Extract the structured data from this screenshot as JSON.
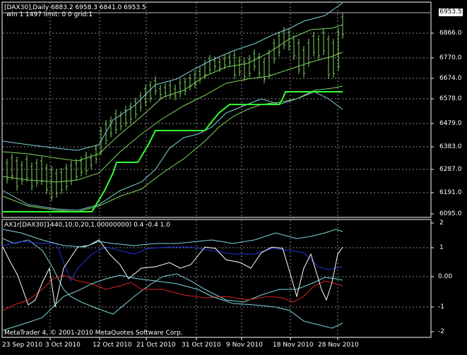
{
  "main_panel": {
    "header_line1": "[DAX30],Daily  6883.2 6958.3 6841.0 6953.5",
    "header_line2": "win 1 1497 limit: 0 0 grid:1",
    "current_price": "6953.5",
    "y_ticks": [
      "6866.0",
      "6770.0",
      "6674.0",
      "6578.0",
      "6479.0",
      "6383.0",
      "6287.0",
      "6191.0",
      "6095.0"
    ]
  },
  "indicator_panel": {
    "header": "AX1r[DAX30]1440,10,0,20,1.00000000) 0.4 -0.4 1.0",
    "y_ticks": [
      "2",
      "1",
      "0.00",
      "-1",
      "-2"
    ],
    "footer": "MetaTrader 4, © 2001-2010 MetaQuotes Software Corp."
  },
  "x_ticks": [
    "23 Sep 2010",
    "3 Oct 2010",
    "12 Oct 2010",
    "21 Oct 2010",
    "31 Oct 2010",
    "9 Nov 2010",
    "18 Nov 2010",
    "28 Nov 2010"
  ],
  "colors": {
    "background": "#000000",
    "grid": "#8a8a8a",
    "bars": "#7cd65c",
    "bright_green": "#33ff33",
    "cyan": "#7fd3d9",
    "blue": "#2233dd",
    "red": "#dd2222",
    "white": "#ffffff"
  }
}
